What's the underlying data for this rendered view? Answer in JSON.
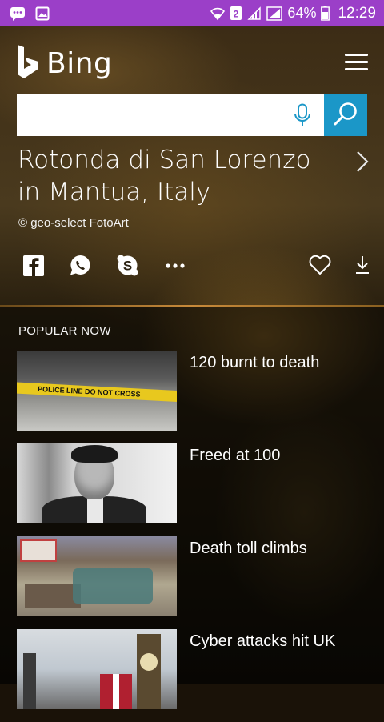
{
  "status_bar": {
    "sim": "2",
    "battery": "64%",
    "time": "12:29",
    "left_icons": [
      "message-icon",
      "image-icon"
    ],
    "right_icons": [
      "wifi-icon",
      "sim-icon",
      "signal-icon",
      "signal-icon",
      "battery-icon"
    ]
  },
  "header": {
    "brand": "Bing",
    "menu_icon": "hamburger-menu-icon"
  },
  "search": {
    "value": "",
    "placeholder": "",
    "mic_icon": "microphone-icon",
    "search_icon": "search-icon",
    "accent_color": "#1b97c8"
  },
  "hero": {
    "title": "Rotonda di San Lorenzo in Mantua, Italy",
    "credit": "© geo-select FotoArt",
    "share_icons": [
      "facebook-icon",
      "whatsapp-icon",
      "skype-icon",
      "more-icon"
    ],
    "action_icons": [
      "heart-icon",
      "download-icon"
    ]
  },
  "popular": {
    "heading": "POPULAR NOW",
    "items": [
      {
        "title": "120 burnt to death",
        "thumb_text": "POLICE LINE  DO NOT CROSS"
      },
      {
        "title": "Freed at 100"
      },
      {
        "title": "Death toll climbs"
      },
      {
        "title": "Cyber attacks hit UK"
      }
    ]
  },
  "colors": {
    "status_bar": "#9b3fc8",
    "divider": "#c88a3a"
  }
}
